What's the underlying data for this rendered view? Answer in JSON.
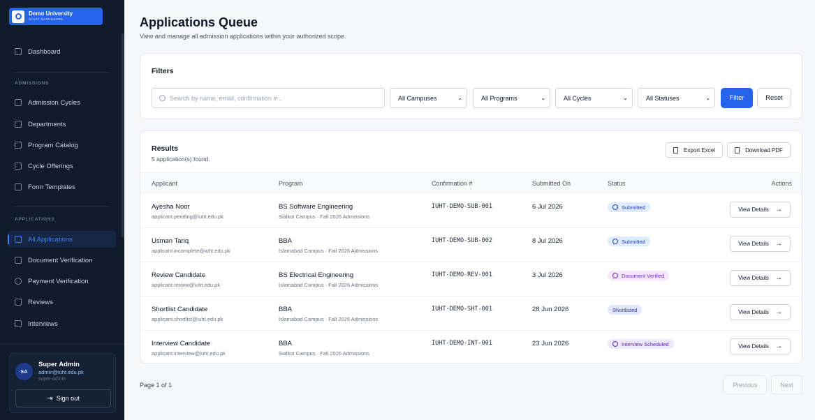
{
  "brand": {
    "title": "Demo University",
    "subtitle": "STAFF DASHBOARD"
  },
  "sidebar": {
    "dashboard": "Dashboard",
    "sections": [
      {
        "label": "ADMISSIONS",
        "items": [
          "Admission Cycles",
          "Departments",
          "Program Catalog",
          "Cycle Offerings",
          "Form Templates"
        ]
      },
      {
        "label": "APPLICATIONS",
        "items": [
          "All Applications",
          "Document Verification",
          "Payment Verification",
          "Reviews",
          "Interviews"
        ]
      }
    ],
    "active": "All Applications"
  },
  "user": {
    "initials": "SA",
    "name": "Super Admin",
    "email": "admin@iuht.edu.pk",
    "role": "super-admin",
    "signout": "Sign out"
  },
  "header": {
    "title": "Applications Queue",
    "subtitle": "View and manage all admission applications within your authorized scope."
  },
  "filters": {
    "title": "Filters",
    "search_placeholder": "Search by name, email, confirmation #...",
    "campus": "All Campuses",
    "program": "All Programs",
    "cycle": "All Cycles",
    "status": "All Statuses",
    "filter_label": "Filter",
    "reset_label": "Reset"
  },
  "results": {
    "title": "Results",
    "count": "5 application(s) found.",
    "export_label": "Export Excel",
    "pdf_label": "Download PDF",
    "columns": {
      "applicant": "Applicant",
      "program": "Program",
      "confirmation": "Confirmation #",
      "submitted": "Submitted On",
      "status": "Status",
      "actions": "Actions"
    },
    "view_label": "View Details",
    "rows": [
      {
        "name": "Ayesha Noor",
        "email": "applicant.pending@iuht.edu.pk",
        "program": "BS Software Engineering",
        "campus": "Sialkot Campus · Fall 2026 Admissions",
        "confirmation": "IUHT-DEMO-SUB-001",
        "date": "6 Jul 2026",
        "status": "Submitted"
      },
      {
        "name": "Usman Tariq",
        "email": "applicant.incomplete@iuht.edu.pk",
        "program": "BBA",
        "campus": "Islamabad Campus · Fall 2026 Admissions",
        "confirmation": "IUHT-DEMO-SUB-002",
        "date": "8 Jul 2026",
        "status": "Submitted"
      },
      {
        "name": "Review Candidate",
        "email": "applicant.review@iuht.edu.pk",
        "program": "BS Electrical Engineering",
        "campus": "Islamabad Campus · Fall 2026 Admissions",
        "confirmation": "IUHT-DEMO-REV-001",
        "date": "3 Jul 2026",
        "status": "Document Verified"
      },
      {
        "name": "Shortlist Candidate",
        "email": "applicant.shortlist@iuht.edu.pk",
        "program": "BBA",
        "campus": "Islamabad Campus · Fall 2026 Admissions",
        "confirmation": "IUHT-DEMO-SHT-001",
        "date": "28 Jun 2026",
        "status": "Shortlisted"
      },
      {
        "name": "Interview Candidate",
        "email": "applicant.interview@iuht.edu.pk",
        "program": "BBA",
        "campus": "Sialkot Campus · Fall 2026 Admissions",
        "confirmation": "IUHT-DEMO-INT-001",
        "date": "23 Jun 2026",
        "status": "Interview Scheduled"
      }
    ]
  },
  "pagination": {
    "text": "Page 1 of 1",
    "previous": "Previous",
    "next": "Next"
  }
}
